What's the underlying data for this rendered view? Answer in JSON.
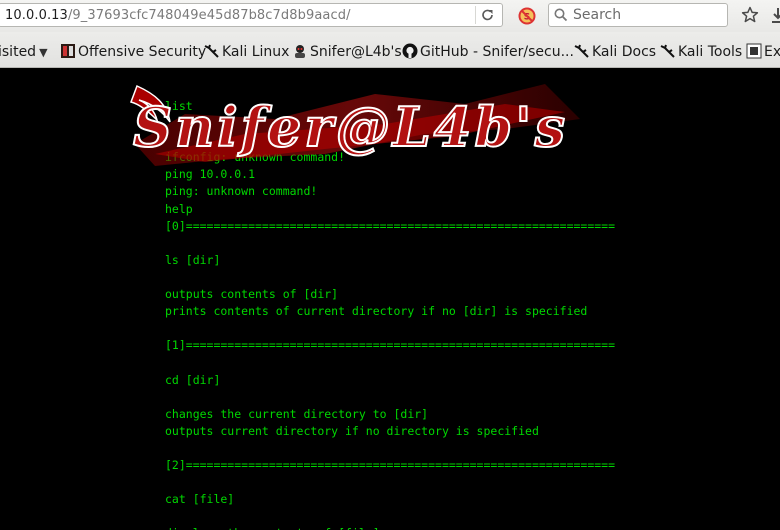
{
  "browser": {
    "url_host": "10.0.0.13",
    "url_path": "/9_37693cfc748049e45d87b8c7d8b9aacd/",
    "search_placeholder": "Search",
    "reload_icon": "reload-icon",
    "noscript_icon": "noscript-icon",
    "bookmark_icon": "star-icon",
    "download_icon": "download-icon"
  },
  "bookmarks": [
    {
      "label": "isited",
      "icon": "none",
      "dropdown": true
    },
    {
      "label": "Offensive Security",
      "icon": "offsec-icon"
    },
    {
      "label": "Kali Linux",
      "icon": "kali-dragon-icon"
    },
    {
      "label": "Snifer@L4b's",
      "icon": "snifer-icon"
    },
    {
      "label": "GitHub - Snifer/secu...",
      "icon": "github-icon"
    },
    {
      "label": "Kali Docs",
      "icon": "kali-dragon-icon"
    },
    {
      "label": "Kali Tools",
      "icon": "kali-dragon-icon"
    },
    {
      "label": "Ex",
      "icon": "exploit-db-icon"
    }
  ],
  "logo": {
    "text": "Snifer@L4b's",
    "colors": {
      "primary": "#c41414",
      "outline": "#ffffff"
    }
  },
  "terminal": {
    "color": "#00d800",
    "background": "#000000",
    "lines": [
      "list",
      "",
      "",
      "ifconfig: unknown command!",
      "ping 10.0.0.1",
      "ping: unknown command!",
      "help",
      "[0]==============================================================",
      "",
      "ls [dir]",
      "",
      "outputs contents of [dir]",
      "prints contents of current directory if no [dir] is specified",
      "",
      "[1]==============================================================",
      "",
      "cd [dir]",
      "",
      "changes the current directory to [dir]",
      "outputs current directory if no directory is specified",
      "",
      "[2]==============================================================",
      "",
      "cat [file]",
      "",
      "displays the contents of [file]"
    ]
  }
}
